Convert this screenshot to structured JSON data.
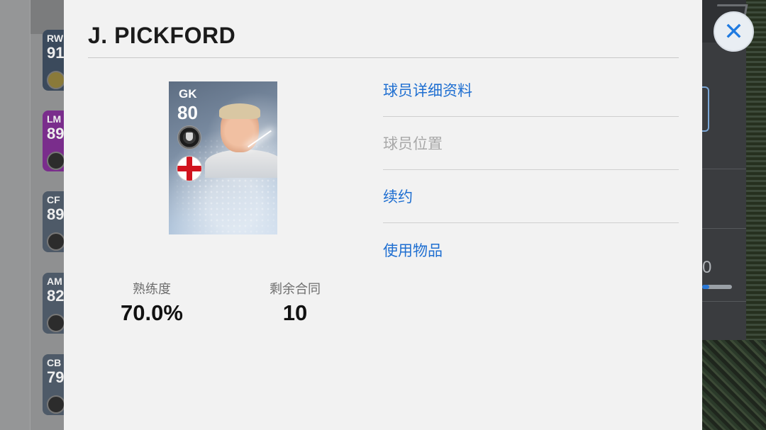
{
  "background": {
    "cards": [
      {
        "position": "RW",
        "rating": "91",
        "color": "#3b4a5c"
      },
      {
        "position": "LM",
        "rating": "89",
        "color": "#7a2d8c"
      },
      {
        "position": "CF",
        "rating": "89",
        "color": "#4e5a68"
      },
      {
        "position": "AM",
        "rating": "82",
        "color": "#4e5a68"
      },
      {
        "position": "CB",
        "rating": "79",
        "color": "#4e5a68"
      }
    ],
    "right_value": "0"
  },
  "modal": {
    "player_name": "J. PICKFORD",
    "card": {
      "position": "GK",
      "rating": "80",
      "nationality_flag": "england-flag-icon",
      "club_badge": "club-badge-icon"
    },
    "stats": {
      "proficiency_label": "熟练度",
      "proficiency_value": "70.0%",
      "contract_label": "剩余合同",
      "contract_value": "10"
    },
    "menu": {
      "player_details": "球员详细资料",
      "player_position": "球员位置",
      "renew_contract": "续约",
      "use_item": "使用物品"
    },
    "close_icon": "close-icon"
  },
  "colors": {
    "accent": "#1f6fd1",
    "disabled": "#a8a8a8",
    "modal_bg": "#f2f2f2"
  }
}
